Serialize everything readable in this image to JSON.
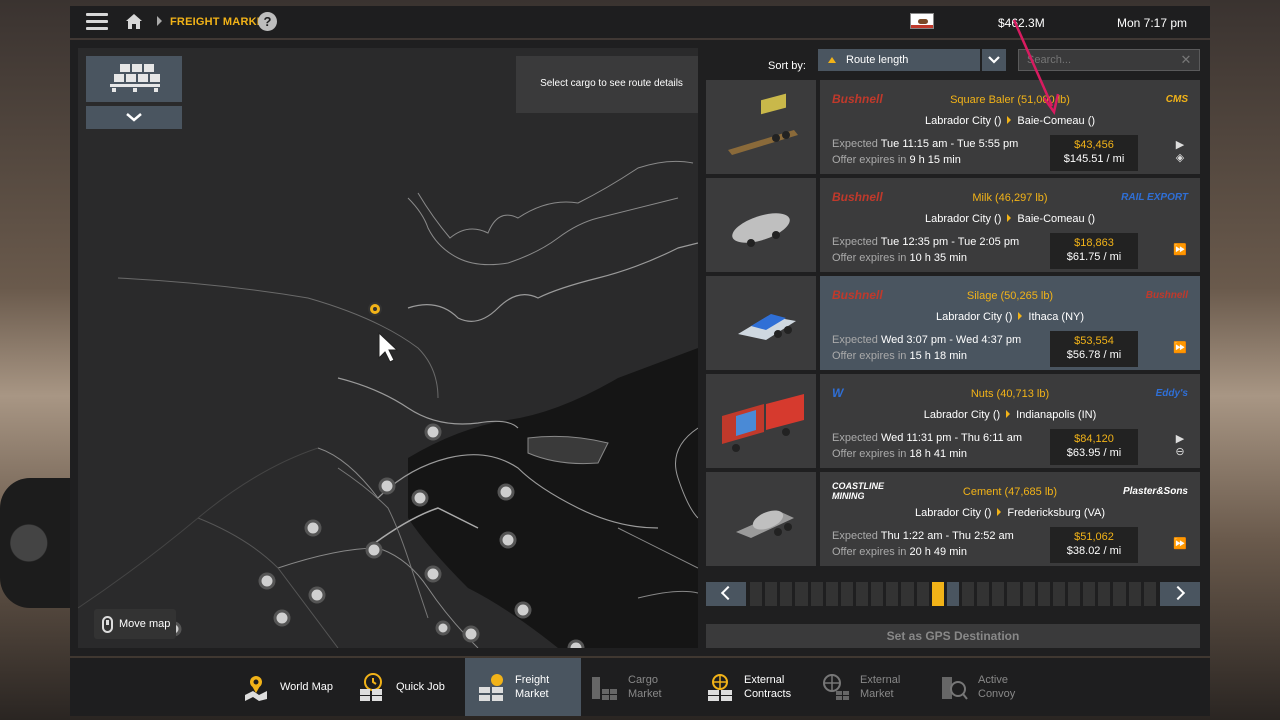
{
  "topbar": {
    "breadcrumb": "FREIGHT MARKET",
    "help": "?",
    "money": "$462.3M",
    "clock": "Mon 7:17 pm"
  },
  "map": {
    "tip": "Select cargo to see route details",
    "move_map": "Move map"
  },
  "sort": {
    "label": "Sort by:",
    "selected": "Route length",
    "search_placeholder": "Search..."
  },
  "jobs": [
    {
      "logo_left": "Bushnell",
      "cargo": "Square Baler (51,000 lb)",
      "origin": "Labrador City ()",
      "dest": "Baie-Comeau ()",
      "logo_right": "CMS",
      "expected_label": "Expected",
      "expected": "Tue 11:15 am - Tue 5:55 pm",
      "offer_label": "Offer expires in",
      "offer": "9 h 15 min",
      "pay": "$43,456",
      "per_mile": "$145.51 / mi"
    },
    {
      "logo_left": "Bushnell",
      "cargo": "Milk (46,297 lb)",
      "origin": "Labrador City ()",
      "dest": "Baie-Comeau ()",
      "logo_right": "RAIL EXPORT",
      "expected_label": "Expected",
      "expected": "Tue 12:35 pm - Tue 2:05 pm",
      "offer_label": "Offer expires in",
      "offer": "10 h 35 min",
      "pay": "$18,863",
      "per_mile": "$61.75 / mi"
    },
    {
      "logo_left": "Bushnell",
      "cargo": "Silage (50,265 lb)",
      "origin": "Labrador City ()",
      "dest": "Ithaca (NY)",
      "logo_right": "Bushnell",
      "expected_label": "Expected",
      "expected": "Wed 3:07 pm - Wed 4:37 pm",
      "offer_label": "Offer expires in",
      "offer": "15 h 18 min",
      "pay": "$53,554",
      "per_mile": "$56.78 / mi"
    },
    {
      "logo_left": "W",
      "cargo": "Nuts (40,713 lb)",
      "origin": "Labrador City ()",
      "dest": "Indianapolis (IN)",
      "logo_right": "Eddy's",
      "expected_label": "Expected",
      "expected": "Wed 11:31 pm - Thu 6:11 am",
      "offer_label": "Offer expires in",
      "offer": "18 h 41 min",
      "pay": "$84,120",
      "per_mile": "$63.95 / mi"
    },
    {
      "logo_left": "COASTLINE MINING",
      "cargo": "Cement (47,685 lb)",
      "origin": "Labrador City ()",
      "dest": "Fredericksburg (VA)",
      "logo_right": "Plaster&Sons",
      "expected_label": "Expected",
      "expected": "Thu 1:22 am - Thu 2:52 am",
      "offer_label": "Offer expires in",
      "offer": "20 h 49 min",
      "pay": "$51,062",
      "per_mile": "$38.02 / mi"
    }
  ],
  "pager": {
    "active_page": 12,
    "page_count": 27
  },
  "gps_button": "Set as GPS Destination",
  "bottomnav": {
    "world_map": "World Map",
    "quick_job": "Quick Job",
    "freight_market": "Freight Market",
    "cargo_market": "Cargo Market",
    "external_contracts": "External Contracts",
    "external_market": "External Market",
    "active_convoy": "Active Convoy"
  },
  "colors": {
    "accent": "#f2b318",
    "panel": "#3b3b3c",
    "selected": "#4a5560",
    "annotation": "#d81b60"
  }
}
